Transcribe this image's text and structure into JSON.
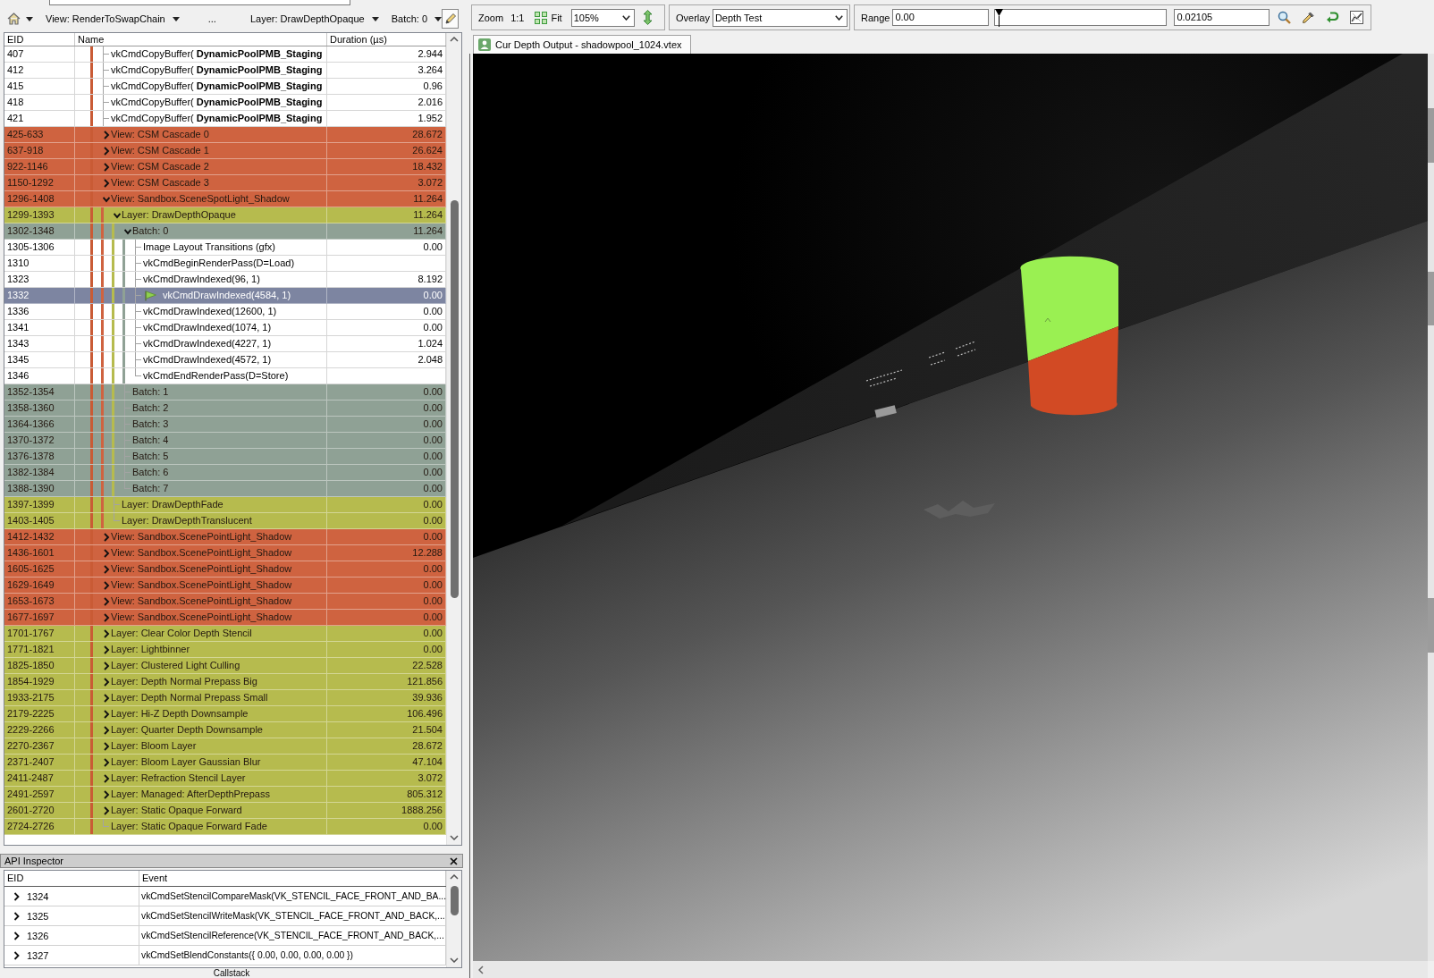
{
  "event_browser": {
    "toolbar": {
      "breadcrumbs": [
        {
          "kind": "dropdown",
          "label": "View: RenderToSwapChain"
        },
        {
          "kind": "text",
          "label": "..."
        },
        {
          "kind": "dropdown",
          "label": "Layer: DrawDepthOpaque"
        },
        {
          "kind": "dropdown",
          "label": "Batch: 0"
        }
      ]
    },
    "columns": [
      "EID",
      "Name",
      "Duration (µs)"
    ],
    "events": [
      {
        "eid": "407",
        "name": "vkCmdCopyBuffer( **DynamicPoolPMB_Staging**",
        "duration": "2.944",
        "kind": "leaf",
        "selected": false
      },
      {
        "eid": "412",
        "name": "vkCmdCopyBuffer( **DynamicPoolPMB_Staging**",
        "duration": "3.264",
        "kind": "leaf",
        "selected": false
      },
      {
        "eid": "415",
        "name": "vkCmdCopyBuffer( **DynamicPoolPMB_Staging**",
        "duration": "0.96",
        "kind": "leaf",
        "selected": false
      },
      {
        "eid": "418",
        "name": "vkCmdCopyBuffer( **DynamicPoolPMB_Staging**",
        "duration": "2.016",
        "kind": "leaf",
        "selected": false
      },
      {
        "eid": "421",
        "name": "vkCmdCopyBuffer( **DynamicPoolPMB_Staging**",
        "duration": "1.952",
        "kind": "leaf",
        "selected": false
      },
      {
        "eid": "425-633",
        "name": "View: CSM Cascade 0",
        "duration": "28.672",
        "kind": "node",
        "expanded": false,
        "color": "#cf6340",
        "selected": false
      },
      {
        "eid": "637-918",
        "name": "View: CSM Cascade 1",
        "duration": "26.624",
        "kind": "node",
        "expanded": false,
        "color": "#cf6340",
        "selected": false
      },
      {
        "eid": "922-1146",
        "name": "View: CSM Cascade 2",
        "duration": "18.432",
        "kind": "node",
        "expanded": false,
        "color": "#cf6340",
        "selected": false
      },
      {
        "eid": "1150-1292",
        "name": "View: CSM Cascade 3",
        "duration": "3.072",
        "kind": "node",
        "expanded": false,
        "color": "#cf6340",
        "selected": false
      },
      {
        "eid": "1296-1408",
        "name": "View: Sandbox.SceneSpotLight_Shadow",
        "duration": "11.264",
        "kind": "node",
        "expanded": true,
        "color": "#cf6340",
        "selected": false,
        "children": [
          {
            "eid": "1299-1393",
            "name": "Layer: DrawDepthOpaque",
            "duration": "11.264",
            "kind": "node",
            "expanded": true,
            "color": "#b6bb4e",
            "selected": false,
            "children": [
              {
                "eid": "1302-1348",
                "name": "Batch: 0",
                "duration": "11.264",
                "kind": "node",
                "expanded": true,
                "color": "#8fa195",
                "selected": false,
                "children": [
                  {
                    "eid": "1305-1306",
                    "name": "Image Layout Transitions (gfx)",
                    "duration": "0.00",
                    "kind": "leaf",
                    "selected": false
                  },
                  {
                    "eid": "1310",
                    "name": "vkCmdBeginRenderPass(D=Load)",
                    "kind": "leaf",
                    "selected": false
                  },
                  {
                    "eid": "1323",
                    "name": "vkCmdDrawIndexed(96, 1)",
                    "duration": "8.192",
                    "kind": "leaf",
                    "selected": false
                  },
                  {
                    "eid": "1332",
                    "name": "vkCmdDrawIndexed(4584, 1)",
                    "duration": "0.00",
                    "kind": "leaf",
                    "selected": true
                  },
                  {
                    "eid": "1336",
                    "name": "vkCmdDrawIndexed(12600, 1)",
                    "duration": "0.00",
                    "kind": "leaf",
                    "selected": false
                  },
                  {
                    "eid": "1341",
                    "name": "vkCmdDrawIndexed(1074, 1)",
                    "duration": "0.00",
                    "kind": "leaf",
                    "selected": false
                  },
                  {
                    "eid": "1343",
                    "name": "vkCmdDrawIndexed(4227, 1)",
                    "duration": "1.024",
                    "kind": "leaf",
                    "selected": false
                  },
                  {
                    "eid": "1345",
                    "name": "vkCmdDrawIndexed(4572, 1)",
                    "duration": "2.048",
                    "kind": "leaf",
                    "selected": false
                  },
                  {
                    "eid": "1346",
                    "name": "vkCmdEndRenderPass(D=Store)",
                    "kind": "leaf",
                    "selected": false
                  }
                ]
              },
              {
                "eid": "1352-1354",
                "name": "Batch: 1",
                "duration": "0.00",
                "kind": "leaf",
                "color": "#8fa195",
                "selected": false
              },
              {
                "eid": "1358-1360",
                "name": "Batch: 2",
                "duration": "0.00",
                "kind": "leaf",
                "color": "#8fa195",
                "selected": false
              },
              {
                "eid": "1364-1366",
                "name": "Batch: 3",
                "duration": "0.00",
                "kind": "leaf",
                "color": "#8fa195",
                "selected": false
              },
              {
                "eid": "1370-1372",
                "name": "Batch: 4",
                "duration": "0.00",
                "kind": "leaf",
                "color": "#8fa195",
                "selected": false
              },
              {
                "eid": "1376-1378",
                "name": "Batch: 5",
                "duration": "0.00",
                "kind": "leaf",
                "color": "#8fa195",
                "selected": false
              },
              {
                "eid": "1382-1384",
                "name": "Batch: 6",
                "duration": "0.00",
                "kind": "leaf",
                "color": "#8fa195",
                "selected": false
              },
              {
                "eid": "1388-1390",
                "name": "Batch: 7",
                "duration": "0.00",
                "kind": "leaf",
                "color": "#8fa195",
                "selected": false
              }
            ]
          },
          {
            "eid": "1397-1399",
            "name": "Layer: DrawDepthFade",
            "duration": "0.00",
            "kind": "leaf",
            "color": "#b6bb4e",
            "selected": false
          },
          {
            "eid": "1403-1405",
            "name": "Layer: DrawDepthTranslucent",
            "duration": "0.00",
            "kind": "leaf",
            "color": "#b6bb4e",
            "selected": false
          }
        ]
      },
      {
        "eid": "1412-1432",
        "name": "View: Sandbox.ScenePointLight_Shadow",
        "duration": "0.00",
        "kind": "node",
        "expanded": false,
        "color": "#cf6340",
        "selected": false
      },
      {
        "eid": "1436-1601",
        "name": "View: Sandbox.ScenePointLight_Shadow",
        "duration": "12.288",
        "kind": "node",
        "expanded": false,
        "color": "#cf6340",
        "selected": false
      },
      {
        "eid": "1605-1625",
        "name": "View: Sandbox.ScenePointLight_Shadow",
        "duration": "0.00",
        "kind": "node",
        "expanded": false,
        "color": "#cf6340",
        "selected": false
      },
      {
        "eid": "1629-1649",
        "name": "View: Sandbox.ScenePointLight_Shadow",
        "duration": "0.00",
        "kind": "node",
        "expanded": false,
        "color": "#cf6340",
        "selected": false
      },
      {
        "eid": "1653-1673",
        "name": "View: Sandbox.ScenePointLight_Shadow",
        "duration": "0.00",
        "kind": "node",
        "expanded": false,
        "color": "#cf6340",
        "selected": false
      },
      {
        "eid": "1677-1697",
        "name": "View: Sandbox.ScenePointLight_Shadow",
        "duration": "0.00",
        "kind": "node",
        "expanded": false,
        "color": "#cf6340",
        "selected": false
      },
      {
        "eid": "1701-1767",
        "name": "Layer: Clear Color Depth Stencil",
        "duration": "0.00",
        "kind": "node",
        "expanded": false,
        "color": "#b6bb4e",
        "selected": false
      },
      {
        "eid": "1771-1821",
        "name": "Layer: Lightbinner",
        "duration": "0.00",
        "kind": "node",
        "expanded": false,
        "color": "#b6bb4e",
        "selected": false
      },
      {
        "eid": "1825-1850",
        "name": "Layer: Clustered Light Culling",
        "duration": "22.528",
        "kind": "node",
        "expanded": false,
        "color": "#b6bb4e",
        "selected": false
      },
      {
        "eid": "1854-1929",
        "name": "Layer: Depth Normal Prepass Big",
        "duration": "121.856",
        "kind": "node",
        "expanded": false,
        "color": "#b6bb4e",
        "selected": false
      },
      {
        "eid": "1933-2175",
        "name": "Layer: Depth Normal Prepass Small",
        "duration": "39.936",
        "kind": "node",
        "expanded": false,
        "color": "#b6bb4e",
        "selected": false
      },
      {
        "eid": "2179-2225",
        "name": "Layer: Hi-Z Depth Downsample",
        "duration": "106.496",
        "kind": "node",
        "expanded": false,
        "color": "#b6bb4e",
        "selected": false
      },
      {
        "eid": "2229-2266",
        "name": "Layer: Quarter Depth Downsample",
        "duration": "21.504",
        "kind": "node",
        "expanded": false,
        "color": "#b6bb4e",
        "selected": false
      },
      {
        "eid": "2270-2367",
        "name": "Layer: Bloom Layer",
        "duration": "28.672",
        "kind": "node",
        "expanded": false,
        "color": "#b6bb4e",
        "selected": false
      },
      {
        "eid": "2371-2407",
        "name": "Layer: Bloom Layer Gaussian Blur",
        "duration": "47.104",
        "kind": "node",
        "expanded": false,
        "color": "#b6bb4e",
        "selected": false
      },
      {
        "eid": "2411-2487",
        "name": "Layer: Refraction Stencil Layer",
        "duration": "3.072",
        "kind": "node",
        "expanded": false,
        "color": "#b6bb4e",
        "selected": false
      },
      {
        "eid": "2491-2597",
        "name": "Layer: Managed: AfterDepthPrepass",
        "duration": "805.312",
        "kind": "node",
        "expanded": false,
        "color": "#b6bb4e",
        "selected": false
      },
      {
        "eid": "2601-2720",
        "name": "Layer: Static Opaque Forward",
        "duration": "1888.256",
        "kind": "node",
        "expanded": false,
        "color": "#b6bb4e",
        "selected": false
      },
      {
        "eid": "2724-2726",
        "name": "Layer: Static Opaque Forward Fade",
        "duration": "0.00",
        "kind": "leaf",
        "color": "#b6bb4e",
        "selected": false
      }
    ]
  },
  "api_inspector": {
    "title": "API Inspector",
    "columns": [
      "EID",
      "Event"
    ],
    "rows": [
      {
        "eid": "1324",
        "event": "vkCmdSetStencilCompareMask(VK_STENCIL_FACE_FRONT_AND_BA...",
        "expanded": false
      },
      {
        "eid": "1325",
        "event": "vkCmdSetStencilWriteMask(VK_STENCIL_FACE_FRONT_AND_BACK,...",
        "expanded": false
      },
      {
        "eid": "1326",
        "event": "vkCmdSetStencilReference(VK_STENCIL_FACE_FRONT_AND_BACK,...",
        "expanded": false
      },
      {
        "eid": "1327",
        "event": "vkCmdSetBlendConstants({ 0.00, 0.00, 0.00, 0.00 })",
        "expanded": false
      }
    ]
  },
  "dock_tab": "Callstack",
  "texture_viewer": {
    "toolbar": {
      "zoom_label": "Zoom",
      "actual_size": "1:1",
      "fit": "Fit",
      "zoom_value": "105%",
      "overlay_label": "Overlay",
      "overlay_value": "Depth Test",
      "range_label": "Range",
      "range_min": "0.00",
      "range_slider": {
        "level": 0
      },
      "range_max": "0.02105"
    },
    "tabs": [
      {
        "label": "Cur Depth Output - shadowpool_1024.vtex",
        "selected": true
      }
    ]
  }
}
